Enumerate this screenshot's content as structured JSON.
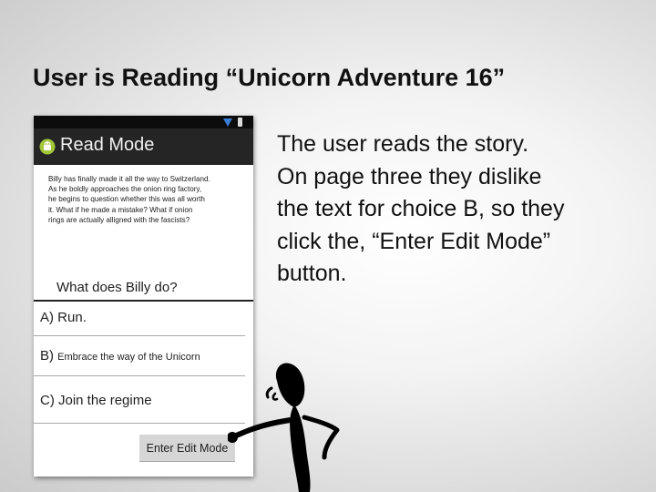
{
  "slide": {
    "title": "User is Reading “Unicorn Adventure 16”",
    "body_lines": [
      "The user reads the story.",
      "On page three they dislike",
      "the text for choice B, so they",
      "click the, “Enter Edit Mode”",
      "button."
    ]
  },
  "phone": {
    "status_bar": {
      "icons": [
        "signal-icon",
        "battery-icon"
      ]
    },
    "action_bar": {
      "app_icon": "android-icon",
      "title": "Read Mode"
    },
    "story_lines": [
      "Billy has finally made it all the way to Switzerland.",
      "As he boldly approaches the onion ring factory,",
      "he begins to question whether this was all worth",
      "it.  What if he made a mistake? What if onion",
      "rings are actually alligned with the fascists?"
    ],
    "question": "What does Billy do?",
    "choices": [
      {
        "letter": "A)",
        "text": "Run."
      },
      {
        "letter": "B)",
        "text": "Embrace the way of the Unicorn"
      },
      {
        "letter": "C)",
        "text": "Join the regime"
      }
    ],
    "edit_button_label": "Enter Edit Mode"
  },
  "illustration": {
    "name": "pointing-stick-figure"
  },
  "colors": {
    "action_bar": "#252525",
    "status_bar": "#0c0c0c",
    "signal_blue": "#3a7bd5",
    "android_green": "#a4c639",
    "button_gray": "#d6d6d6"
  }
}
